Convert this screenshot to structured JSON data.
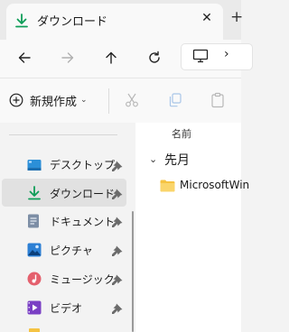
{
  "tab": {
    "title": "ダウンロード",
    "close_glyph": "✕",
    "new_tab_glyph": "+"
  },
  "nav": {
    "back_icon": "arrow-left-icon",
    "forward_icon": "arrow-right-icon",
    "up_icon": "arrow-up-icon",
    "refresh_icon": "refresh-icon",
    "address_icon": "monitor-icon",
    "address_chevron": "›"
  },
  "command_bar": {
    "new_label": "新規作成",
    "new_caret": "⌄",
    "cut_icon": "scissors-icon",
    "copy_icon": "copy-icon",
    "paste_icon": "clipboard-icon"
  },
  "sidebar": {
    "items": [
      {
        "label": "デスクトップ",
        "icon": "desktop-icon",
        "pinned": true,
        "selected": false
      },
      {
        "label": "ダウンロード",
        "icon": "download-icon",
        "pinned": true,
        "selected": true
      },
      {
        "label": "ドキュメント",
        "icon": "document-icon",
        "pinned": true,
        "selected": false
      },
      {
        "label": "ピクチャ",
        "icon": "pictures-icon",
        "pinned": true,
        "selected": false
      },
      {
        "label": "ミュージック",
        "icon": "music-icon",
        "pinned": true,
        "selected": false
      },
      {
        "label": "ビデオ",
        "icon": "video-icon",
        "pinned": true,
        "selected": false
      }
    ]
  },
  "content": {
    "column_name": "名前",
    "group_label": "先月",
    "group_chevron": "⌄",
    "rows": [
      {
        "name": "MicrosoftWin",
        "icon": "folder-icon"
      }
    ]
  },
  "colors": {
    "accent": "#0f9d58",
    "folder": "#f5c342",
    "selected_bg": "#e1e1e1"
  }
}
